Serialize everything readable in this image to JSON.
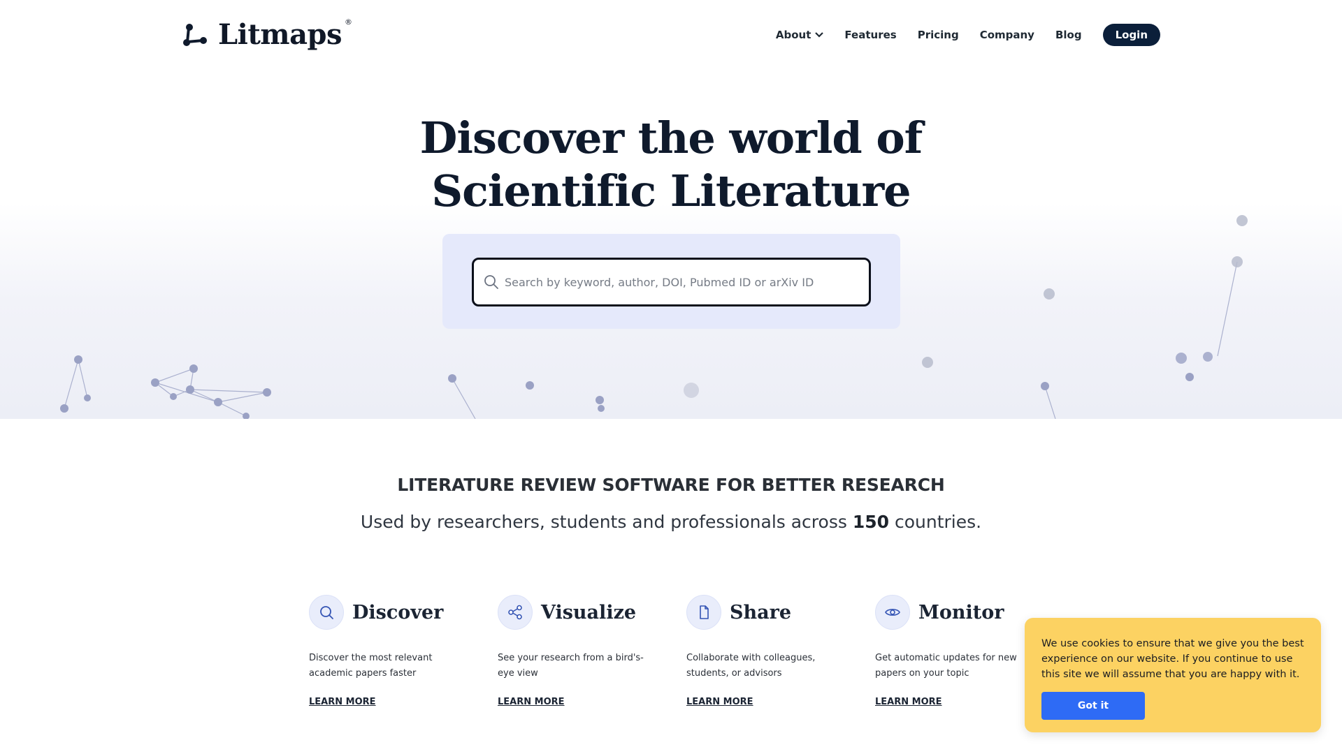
{
  "header": {
    "logo_text": "Litmaps",
    "logo_reg": "®",
    "nav": {
      "about": "About",
      "features": "Features",
      "pricing": "Pricing",
      "company": "Company",
      "blog": "Blog",
      "login": "Login"
    }
  },
  "hero": {
    "title_line1": "Discover the world of",
    "title_line2": "Scientific Literature",
    "search_placeholder": "Search by keyword, author, DOI, Pubmed ID or arXiv ID"
  },
  "tagline": {
    "title": "LITERATURE REVIEW SOFTWARE FOR BETTER RESEARCH",
    "sub_prefix": "Used by researchers, students and professionals across ",
    "sub_number": "150",
    "sub_suffix": " countries."
  },
  "features": [
    {
      "icon": "search-icon",
      "title": "Discover",
      "desc": "Discover the most relevant academic papers faster",
      "link": "LEARN MORE"
    },
    {
      "icon": "share-nodes-icon",
      "title": "Visualize",
      "desc": "See your research from a bird's-eye view",
      "link": "LEARN MORE"
    },
    {
      "icon": "document-icon",
      "title": "Share",
      "desc": "Collaborate with colleagues, students, or advisors",
      "link": "LEARN MORE"
    },
    {
      "icon": "eye-icon",
      "title": "Monitor",
      "desc": "Get automatic updates for new papers on your topic",
      "link": "LEARN MORE"
    }
  ],
  "cookie": {
    "text": "We use cookies to ensure that we give you the best experience on our website. If you continue to use this site we will assume that you are happy with it.",
    "button": "Got it"
  },
  "colors": {
    "brand_dark": "#0b1f3a",
    "accent_blue": "#2e6bf5",
    "cookie_bg": "#fcd262",
    "search_panel": "#e5e9fb"
  }
}
